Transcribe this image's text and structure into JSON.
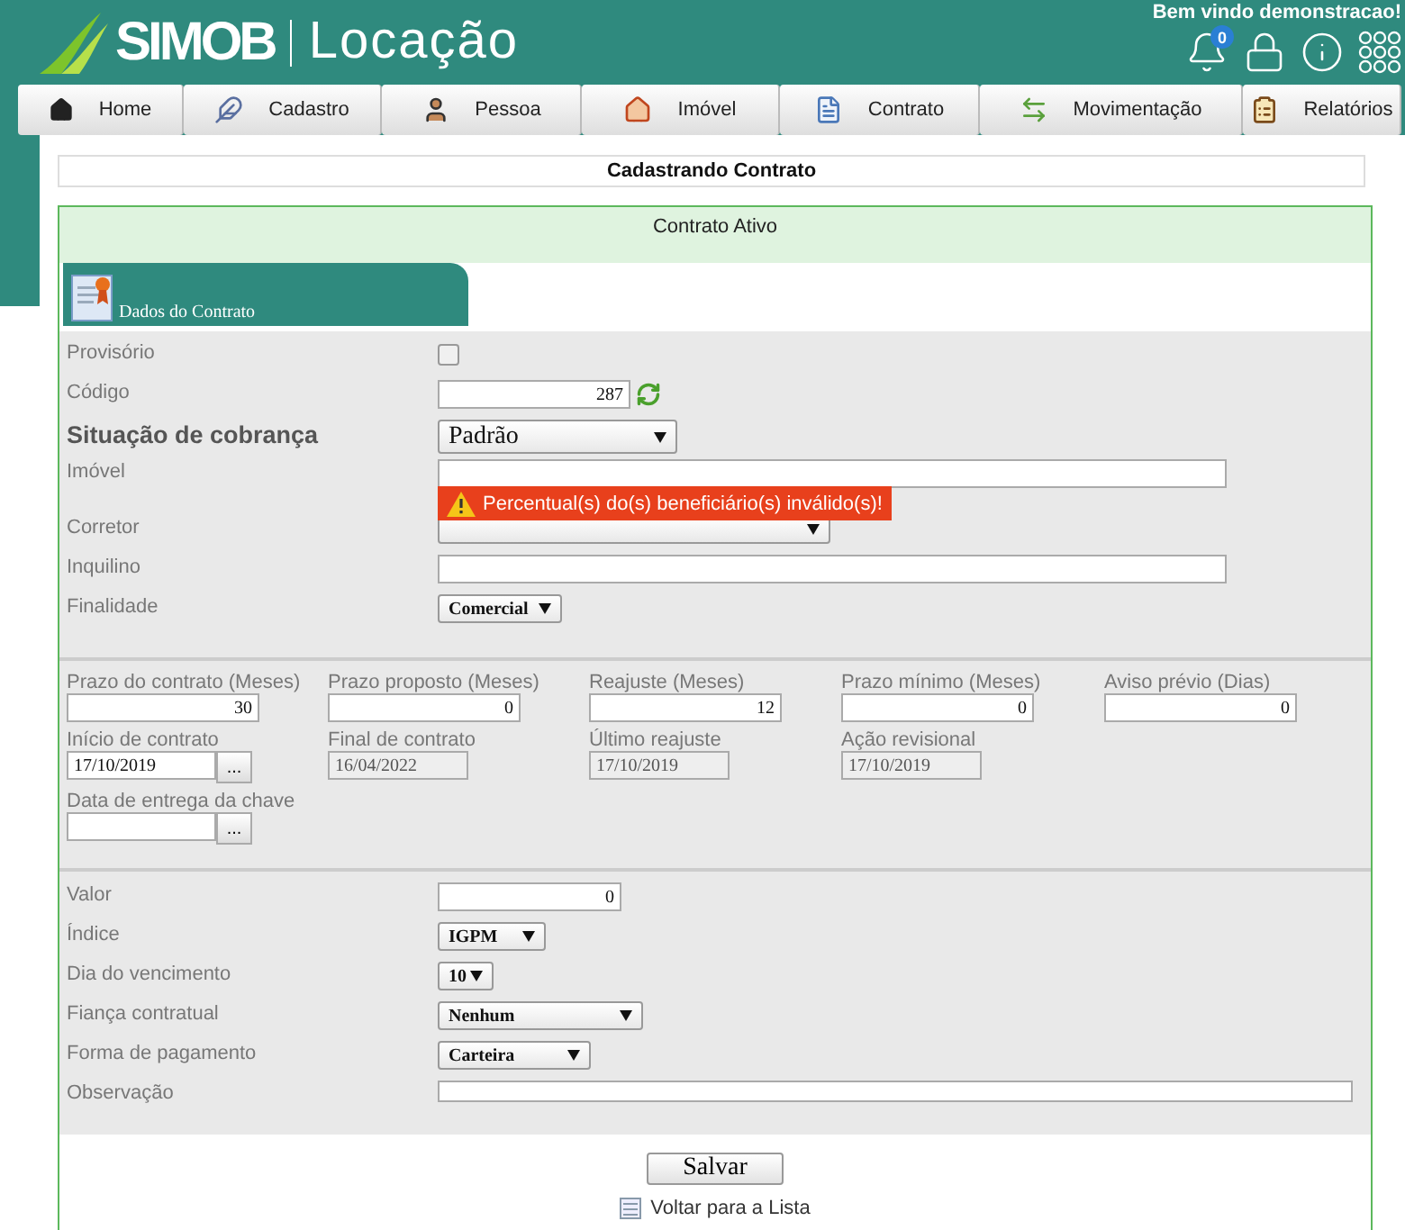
{
  "header": {
    "brand": "SIMOB",
    "product": "Locação",
    "welcome": "Bem vindo demonstracao!",
    "notification_count": "0"
  },
  "nav": {
    "items": [
      {
        "label": "Home"
      },
      {
        "label": "Cadastro"
      },
      {
        "label": "Pessoa"
      },
      {
        "label": "Imóvel"
      },
      {
        "label": "Contrato"
      },
      {
        "label": "Movimentação"
      },
      {
        "label": "Relatórios"
      }
    ]
  },
  "page_title": "Cadastrando Contrato",
  "status": "Contrato Ativo",
  "tab": {
    "label": "Dados do Contrato"
  },
  "main_fields": [
    {
      "kind": "checkbox",
      "label": "Provisório",
      "checked": false
    },
    {
      "kind": "code",
      "label": "Código",
      "value": "287"
    },
    {
      "kind": "large_select",
      "label": "Situação de cobrança",
      "value": "Padrão"
    },
    {
      "kind": "text",
      "label": "Imóvel",
      "error": "Percentual(s) do(s) beneficiário(s) inválido(s)!"
    },
    {
      "kind": "select",
      "label": "Corretor"
    },
    {
      "kind": "text",
      "label": "Inquilino"
    },
    {
      "kind": "select",
      "label": "Finalidade",
      "value": "Comercial"
    }
  ],
  "term_rows": [
    [
      {
        "kind": "number",
        "label": "Prazo do contrato (Meses)",
        "value": "30"
      },
      {
        "kind": "number",
        "label": "Prazo proposto (Meses)",
        "value": "0"
      },
      {
        "kind": "number",
        "label": "Reajuste (Meses)",
        "value": "12"
      },
      {
        "kind": "number",
        "label": "Prazo mínimo (Meses)",
        "value": "0"
      },
      {
        "kind": "number",
        "label": "Aviso prévio (Dias)",
        "value": "0"
      }
    ],
    [
      {
        "kind": "date_picker",
        "label": "Início de contrato",
        "value": "17/10/2019",
        "button": "..."
      },
      {
        "kind": "readonly",
        "label": "Final de contrato",
        "value": "16/04/2022"
      },
      {
        "kind": "readonly",
        "label": "Último reajuste",
        "value": "17/10/2019"
      },
      {
        "kind": "readonly",
        "label": "Ação revisional",
        "value": "17/10/2019"
      }
    ],
    [
      {
        "kind": "date_picker",
        "label": "Data de entrega da chave",
        "button": "..."
      }
    ]
  ],
  "payment_fields": [
    {
      "kind": "number",
      "label": "Valor",
      "value": "0"
    },
    {
      "kind": "select",
      "label": "Índice",
      "value": "IGPM"
    },
    {
      "kind": "select",
      "label": "Dia do vencimento",
      "value": "10"
    },
    {
      "kind": "select",
      "label": "Fiança contratual",
      "value": "Nenhum"
    },
    {
      "kind": "select",
      "label": "Forma de pagamento",
      "value": "Carteira"
    },
    {
      "kind": "textarea",
      "label": "Observação"
    }
  ],
  "save_button": "Salvar",
  "back_link": "Voltar para a Lista"
}
